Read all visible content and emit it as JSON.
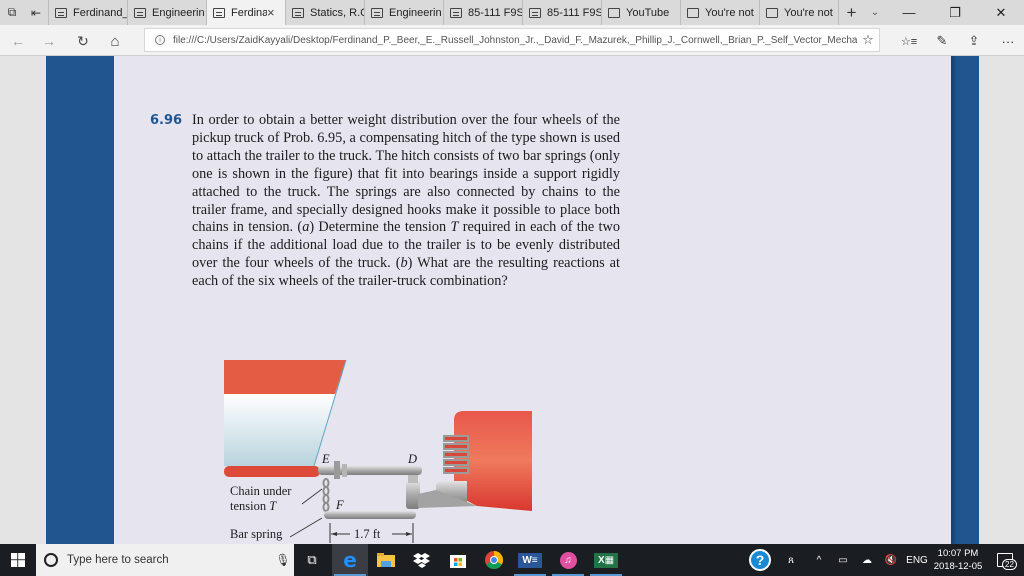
{
  "browser": {
    "tabs": [
      {
        "label": "Ferdinand_",
        "icon": "pdf-icon",
        "active": false
      },
      {
        "label": "Engineerin",
        "icon": "pdf-icon",
        "active": false
      },
      {
        "label": "Ferdina",
        "icon": "pdf-icon",
        "active": true,
        "close": "×"
      },
      {
        "label": "Statics, R.C",
        "icon": "pdf-icon",
        "active": false
      },
      {
        "label": "Engineerin",
        "icon": "pdf-icon",
        "active": false
      },
      {
        "label": "85-111 F9S",
        "icon": "pdf-icon",
        "active": false
      },
      {
        "label": "85-111 F9S",
        "icon": "pdf-icon",
        "active": false
      },
      {
        "label": "YouTube",
        "icon": "page-icon",
        "active": false
      },
      {
        "label": "You're not",
        "icon": "page-icon",
        "active": false
      },
      {
        "label": "You're not",
        "icon": "page-icon",
        "active": false
      }
    ],
    "strip_buttons": {
      "tab_manager": "⧉",
      "set_aside": "⇤",
      "new_tab": "+",
      "tab_list": "⌄"
    },
    "window_controls": {
      "minimize": "—",
      "restore": "❐",
      "close": "✕"
    },
    "nav": {
      "back": "←",
      "forward": "→",
      "refresh": "↻",
      "home": "⌂"
    },
    "address": {
      "info_glyph": "i",
      "url": "file:///C:/Users/ZaidKayyali/Desktop/Ferdinand_P._Beer,_E._Russell_Johnston_Jr.,_David_F._Mazurek,_Phillip_J._Cornwell,_Brian_P._Self_Vector_Mechanics_For_En",
      "favorite_glyph": "☆"
    },
    "toolbar": {
      "favorites": "☆≡",
      "notes": "✎",
      "share": "⇪",
      "more": "···"
    }
  },
  "document": {
    "problem_number": "6.96",
    "problem_text_parts": [
      "In order to obtain a better weight distribution over the four wheels of the pickup truck of Prob. 6.95, a compensating hitch of the type shown is used to attach the trailer to the truck. The hitch consists of two bar springs (only one is shown in the figure) that fit into bearings inside a support rigidly attached to the truck. The springs are also connected by chains to the trailer frame, and specially designed hooks make it possible to place both chains in tension. (",
      "a",
      ") Determine the tension ",
      "T",
      " required in each of the two chains if the additional load due to the trailer is to be evenly distributed over the four wheels of the truck. (",
      "b",
      ") What are the resulting reactions at each of the six wheels of the trailer-truck combination?"
    ],
    "figure": {
      "label_E": "E",
      "label_D": "D",
      "label_F": "F",
      "chain_label_line1": "Chain under",
      "chain_label_line2": "tension ",
      "chain_label_T": "T",
      "spring_label": "Bar spring",
      "dimension": "1.7 ft"
    }
  },
  "taskbar": {
    "search_placeholder": "Type here to search",
    "mic_glyph": "🎙",
    "task_view_glyph": "⧉",
    "apps": [
      "edge",
      "file-explorer",
      "dropbox",
      "store",
      "chrome",
      "word",
      "itunes",
      "excel"
    ],
    "tray": {
      "help": "?",
      "people": "ጸ",
      "chevron": "^",
      "battery": "▭",
      "onedrive": "☁",
      "volume": "🔇",
      "language": "ENG"
    },
    "clock_time": "10:07 PM",
    "clock_date": "2018-12-05",
    "notifications_count": "22"
  }
}
